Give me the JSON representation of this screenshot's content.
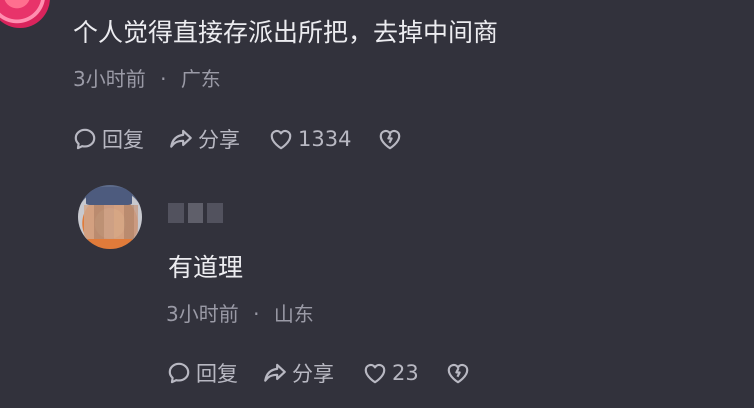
{
  "comment": {
    "text": "个人觉得直接存派出所把，去掉中间商",
    "time": "3小时前",
    "separator": "·",
    "location": "广东",
    "actions": {
      "reply_label": "回复",
      "share_label": "分享",
      "like_count": "1334"
    }
  },
  "reply": {
    "text": "有道理",
    "time": "3小时前",
    "separator": "·",
    "location": "山东",
    "actions": {
      "reply_label": "回复",
      "share_label": "分享",
      "like_count": "23"
    }
  },
  "colors": {
    "background": "#32323c",
    "primary_text": "#ececf0",
    "secondary_text": "#9a9aa6",
    "action_text": "#b8b8c2"
  },
  "icons": [
    "reply-bubble-icon",
    "share-arrow-icon",
    "heart-icon",
    "broken-heart-icon"
  ]
}
